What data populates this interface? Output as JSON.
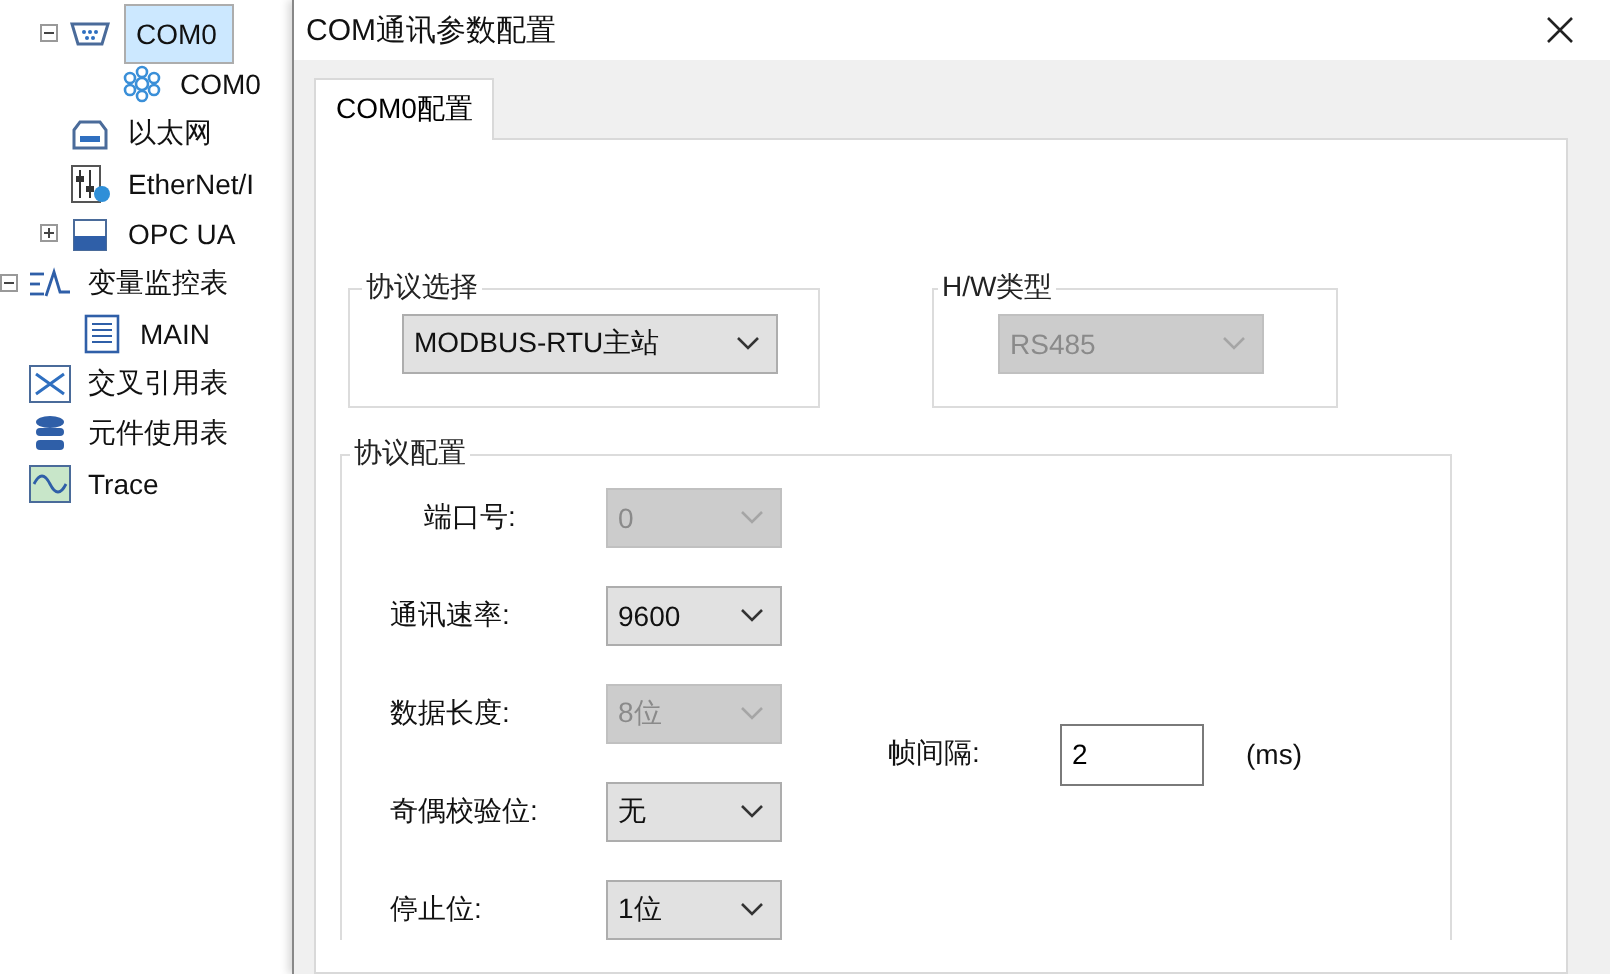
{
  "tree": {
    "nested_items": [
      {
        "label": "COM0",
        "kind": "serial-port",
        "selected": true,
        "expanded": true,
        "children": [
          {
            "label": "COM0",
            "kind": "network-node",
            "selected": false
          }
        ]
      },
      {
        "label": "以太网",
        "kind": "ethernet",
        "selected": false
      },
      {
        "label": "EtherNet/I",
        "kind": "ethernet-ip",
        "selected": false
      },
      {
        "label": "OPC UA",
        "kind": "opc",
        "selected": false,
        "expanded": false
      }
    ],
    "items": [
      {
        "label": "变量监控表",
        "kind": "monitor",
        "selected": false,
        "expanded": true,
        "children": [
          {
            "label": "MAIN",
            "kind": "document",
            "selected": false
          }
        ]
      },
      {
        "label": "交叉引用表",
        "kind": "cross-ref",
        "selected": false
      },
      {
        "label": "元件使用表",
        "kind": "database",
        "selected": false
      },
      {
        "label": "Trace",
        "kind": "trace",
        "selected": false
      }
    ]
  },
  "dialog": {
    "title": "COM通讯参数配置",
    "tabs": [
      {
        "label": "COM0配置",
        "selected": true
      }
    ],
    "protocol_group": {
      "title": "协议选择",
      "value": "MODBUS-RTU主站",
      "disabled": false
    },
    "hw_group": {
      "title": "H/W类型",
      "value": "RS485",
      "disabled": true
    },
    "config_group": {
      "title": "协议配置",
      "fields": [
        {
          "label": "端口号:",
          "value": "0",
          "disabled": true
        },
        {
          "label": "通讯速率:",
          "value": "9600",
          "disabled": false
        },
        {
          "label": "数据长度:",
          "value": "8位",
          "disabled": true
        },
        {
          "label": "奇偶校验位:",
          "value": "无",
          "disabled": false
        },
        {
          "label": "停止位:",
          "value": "1位",
          "disabled": false
        }
      ],
      "frame_interval": {
        "label": "帧间隔:",
        "value": "2",
        "unit": "(ms)"
      }
    }
  }
}
